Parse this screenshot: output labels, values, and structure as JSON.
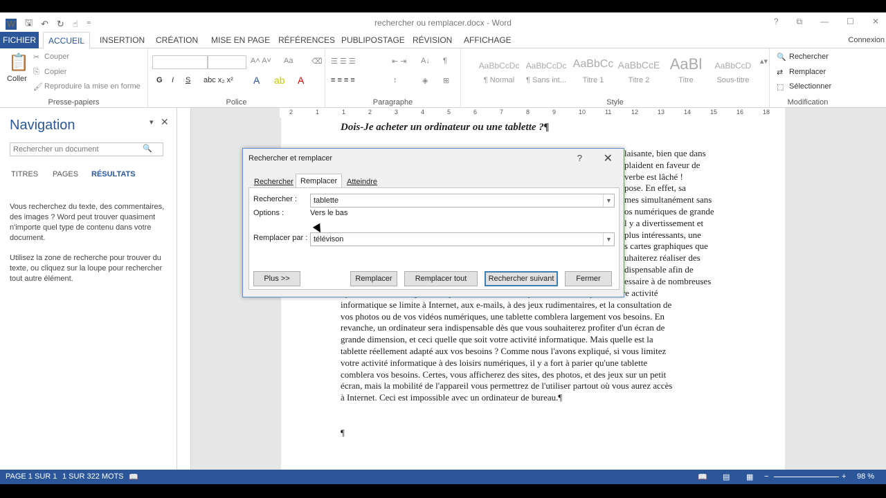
{
  "window": {
    "title": "rechercher ou remplacer.docx - Word",
    "signin": "Connexion"
  },
  "tabs": [
    "FICHIER",
    "ACCUEIL",
    "INSERTION",
    "CRÉATION",
    "MISE EN PAGE",
    "RÉFÉRENCES",
    "PUBLIPOSTAGE",
    "RÉVISION",
    "AFFICHAGE"
  ],
  "ribbon": {
    "clipboard": {
      "paste": "Coller",
      "cut": "Couper",
      "copy": "Copier",
      "format_painter": "Reproduire la mise en forme",
      "label": "Presse-papiers"
    },
    "font": {
      "label": "Police"
    },
    "paragraph": {
      "label": "Paragraphe"
    },
    "styles": {
      "label": "Style",
      "items": [
        {
          "preview": "AaBbCcDc",
          "name": "¶ Normal"
        },
        {
          "preview": "AaBbCcDc",
          "name": "¶ Sans int..."
        },
        {
          "preview": "AaBbCc",
          "name": "Titre 1"
        },
        {
          "preview": "AaBbCcE",
          "name": "Titre 2"
        },
        {
          "preview": "AaBl",
          "name": "Titre"
        },
        {
          "preview": "AaBbCcD",
          "name": "Sous-titre"
        }
      ]
    },
    "editing": {
      "find": "Rechercher",
      "replace": "Remplacer",
      "select": "Sélectionner",
      "label": "Modification"
    }
  },
  "navigation": {
    "title": "Navigation",
    "search_placeholder": "Rechercher un document",
    "tabs": [
      "TITRES",
      "PAGES",
      "RÉSULTATS"
    ],
    "text1": "Vous recherchez du texte, des commentaires, des images ? Word peut trouver quasiment n'importe quel type de contenu dans votre document.",
    "text2": "Utilisez la zone de recherche pour trouver du texte, ou cliquez sur la loupe pour rechercher tout autre élément."
  },
  "ruler": {
    "numbers": [
      "2",
      "1",
      "1",
      "2",
      "3",
      "4",
      "5",
      "6",
      "7",
      "8",
      "9",
      "10",
      "11",
      "12",
      "13",
      "14",
      "15",
      "16",
      "18"
    ]
  },
  "document": {
    "heading": "Dois-Je acheter un ordinateur ou une tablette ?¶",
    "right_fragments": [
      "laisante, bien que dans",
      "plaident en faveur de",
      "verbe est lâché !",
      "pose. En effet, sa",
      "mes simultanément sans",
      "os numériques de grande",
      "l y a divertissement et",
      "plus intéressants, une",
      "s cartes graphiques que",
      "uhaiterez réaliser des",
      "dispensable afin de",
      "essaire à de nombreuses"
    ],
    "lines": [
      "opérations de montage en temps réel. Pour faire simple, nous dirons que si votre activité",
      "informatique se limite à Internet, aux e-mails, à des jeux rudimentaires, et la consultation de",
      "vos photos ou de vos vidéos numériques, une tablette comblera largement vos besoins. En",
      "revanche, un ordinateur sera indispensable dès que vous souhaiterez profiter d'un écran de",
      "grande dimension, et ceci quelle que soit votre activité informatique. Mais quelle est la",
      "tablette réellement adapté aux vos besoins ? Comme nous l'avons expliqué, si vous limitez",
      "votre activité informatique à des loisirs numériques, il y a fort à parier qu'une tablette",
      "comblera vos besoins. Certes, vous afficherez des sites, des photos, et des jeux sur un petit",
      "écran, mais la mobilité de l'appareil vous permettrez de l'utiliser partout où vous aurez accès",
      "à Internet. Ceci est impossible avec un ordinateur de bureau.¶"
    ],
    "pilcrow": "¶"
  },
  "dialog": {
    "title": "Rechercher et remplacer",
    "help": "?",
    "close": "✕",
    "tabs": [
      "Rechercher",
      "Remplacer",
      "Atteindre"
    ],
    "find_label": "Rechercher :",
    "find_value": "tablette",
    "options_label": "Options :",
    "options_value": "Vers le bas",
    "replace_label": "Remplacer par :",
    "replace_value": "télévison",
    "buttons": {
      "more": "Plus >>",
      "replace": "Remplacer",
      "replace_all": "Remplacer tout",
      "find_next": "Rechercher suivant",
      "close": "Fermer"
    }
  },
  "status": {
    "page": "PAGE 1 SUR 1",
    "words": "1 SUR 322 MOTS",
    "zoom": "98 %"
  }
}
